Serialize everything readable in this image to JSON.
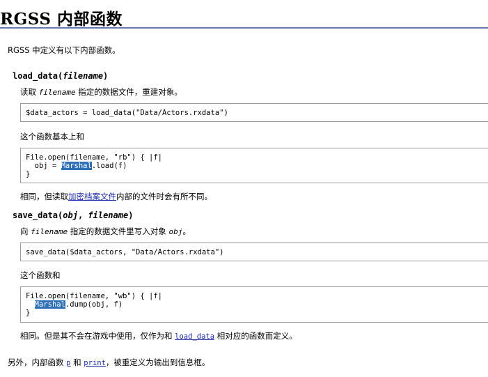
{
  "title": "RGSS 内部函数",
  "intro": "RGSS 中定义有以下内部函数。",
  "load_data": {
    "sig_name": "load_data(",
    "sig_arg": "filename",
    "sig_close": ")",
    "desc_pre": "读取 ",
    "desc_arg": "filename",
    "desc_post": " 指定的数据文件，重建对象。",
    "code1": "$data_actors = load_data(\"Data/Actors.rxdata\")",
    "note": "这个函数基本上和",
    "code2_line1": "File.open(filename, \"rb\") { |f|",
    "code2_line2_pre": "  obj = ",
    "code2_highlight": "Marshal",
    "code2_line2_post": ".load(f)",
    "code2_line3": "}",
    "after_pre": "相同，但读取",
    "after_link": "加密档案文件",
    "after_post": "内部的文件时会有所不同。"
  },
  "save_data": {
    "sig_name": "save_data(",
    "sig_arg1": "obj",
    "sig_sep": ", ",
    "sig_arg2": "filename",
    "sig_close": ")",
    "desc_pre": "向 ",
    "desc_arg": "filename",
    "desc_mid": " 指定的数据文件里写入对象 ",
    "desc_arg2": "obj",
    "desc_post": "。",
    "code1": "save_data($data_actors, \"Data/Actors.rxdata\")",
    "note": "这个函数和",
    "code2_line1": "File.open(filename, \"wb\") { |f|",
    "code2_line2_pre": "  ",
    "code2_highlight": "Marshal",
    "code2_line2_post": ".dump(obj, f)",
    "code2_line3": "}",
    "after_pre": "相同。但是其不会在游戏中使用，仅作为和 ",
    "after_link": "load_data",
    "after_post": " 相对应的函数而定义。"
  },
  "footer": {
    "pre": "另外，内部函数 ",
    "link_p": "p",
    "mid": " 和 ",
    "link_print": "print",
    "post": "，被重定义为输出到信息框。"
  }
}
